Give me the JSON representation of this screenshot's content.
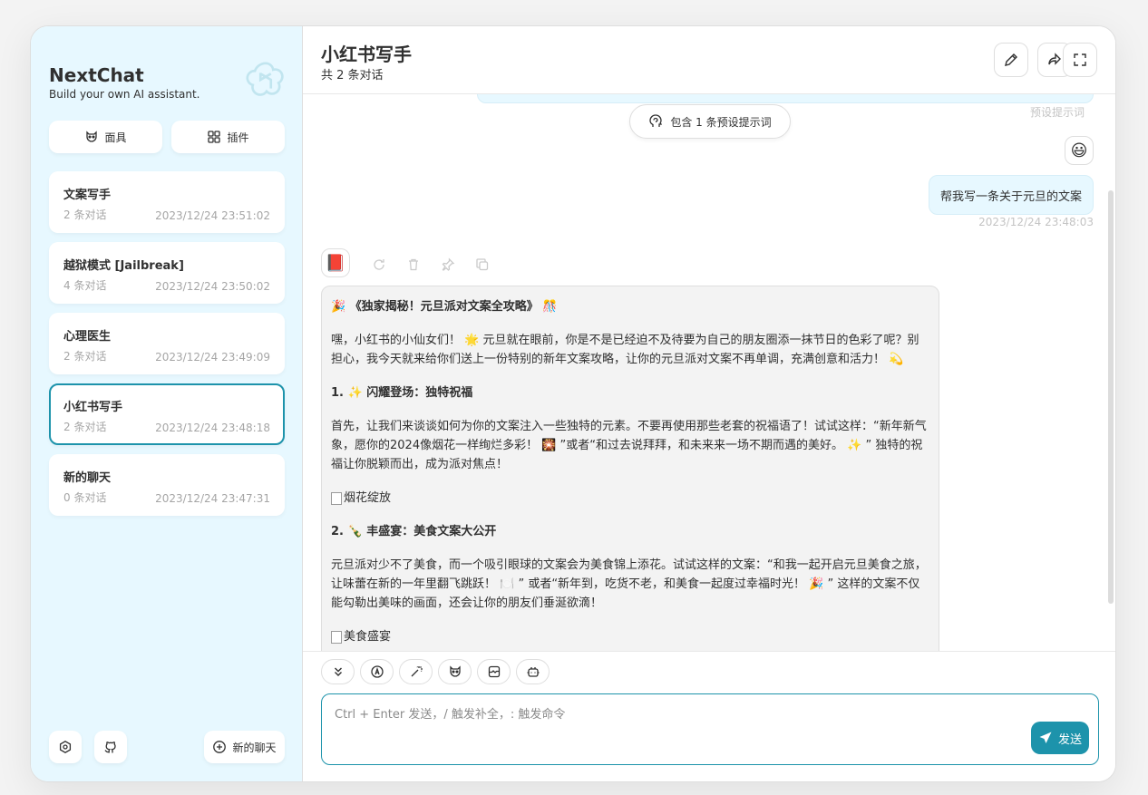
{
  "brand": {
    "title": "NextChat",
    "subtitle": "Build your own AI assistant."
  },
  "sidebar": {
    "masks_label": "面具",
    "plugins_label": "插件",
    "new_chat_label": "新的聊天",
    "chats": [
      {
        "title": "文案写手",
        "count": "2 条对话",
        "date": "2023/12/24 23:51:02"
      },
      {
        "title": "越狱模式 [Jailbreak]",
        "count": "4 条对话",
        "date": "2023/12/24 23:50:02"
      },
      {
        "title": "心理医生",
        "count": "2 条对话",
        "date": "2023/12/24 23:49:09"
      },
      {
        "title": "小红书写手",
        "count": "2 条对话",
        "date": "2023/12/24 23:48:18"
      },
      {
        "title": "新的聊天",
        "count": "0 条对话",
        "date": "2023/12/24 23:47:31"
      }
    ]
  },
  "header": {
    "title": "小红书写手",
    "subtitle": "共 2 条对话"
  },
  "messages": {
    "preset_hint": "预设提示词",
    "preset_pill": "包含 1 条预设提示词",
    "user_avatar": "😃",
    "user_text": "帮我写一条关于元旦的文案",
    "user_time": "2023/12/24 23:48:03",
    "bot_avatar": "📕",
    "bot": {
      "heading": "🎉 《独家揭秘！元旦派对文案全攻略》 🎊",
      "p1": "嘿，小红书的小仙女们！ 🌟 元旦就在眼前，你是不是已经迫不及待要为自己的朋友圈添一抹节日的色彩了呢？别担心，我今天就来给你们送上一份特别的新年文案攻略，让你的元旦派对文案不再单调，充满创意和活力！ 💫",
      "s1": "1. ✨ 闪耀登场：独特祝福",
      "p2": "首先，让我们来谈谈如何为你的文案注入一些独特的元素。不要再使用那些老套的祝福语了！试试这样：“新年新气象，愿你的2024像烟花一样绚烂多彩！ 🎇 ”或者“和过去说拜拜，和未来来一场不期而遇的美好。 ✨ ” 独特的祝福让你脱颖而出，成为派对焦点！",
      "img1": "烟花绽放",
      "s2": "2. 🍾 丰盛宴：美食文案大公开",
      "p3": "元旦派对少不了美食，而一个吸引眼球的文案会为美食锦上添花。试试这样的文案：“和我一起开启元旦美食之旅，让味蕾在新的一年里翻飞跳跃！ 🍽️ ” 或者“新年到，吃货不老，和美食一起度过幸福时光！ 🎉 ” 这样的文案不仅能勾勒出美味的画面，还会让你的朋友们垂涎欲滴！",
      "img2": "美食盛宴"
    }
  },
  "input": {
    "placeholder": "Ctrl + Enter 发送，/ 触发补全，: 触发命令",
    "send_label": "发送"
  },
  "colors": {
    "accent": "#1d93ab",
    "sidebar_bg": "#e7f8ff",
    "bubble_bot": "#f3f3f3"
  }
}
